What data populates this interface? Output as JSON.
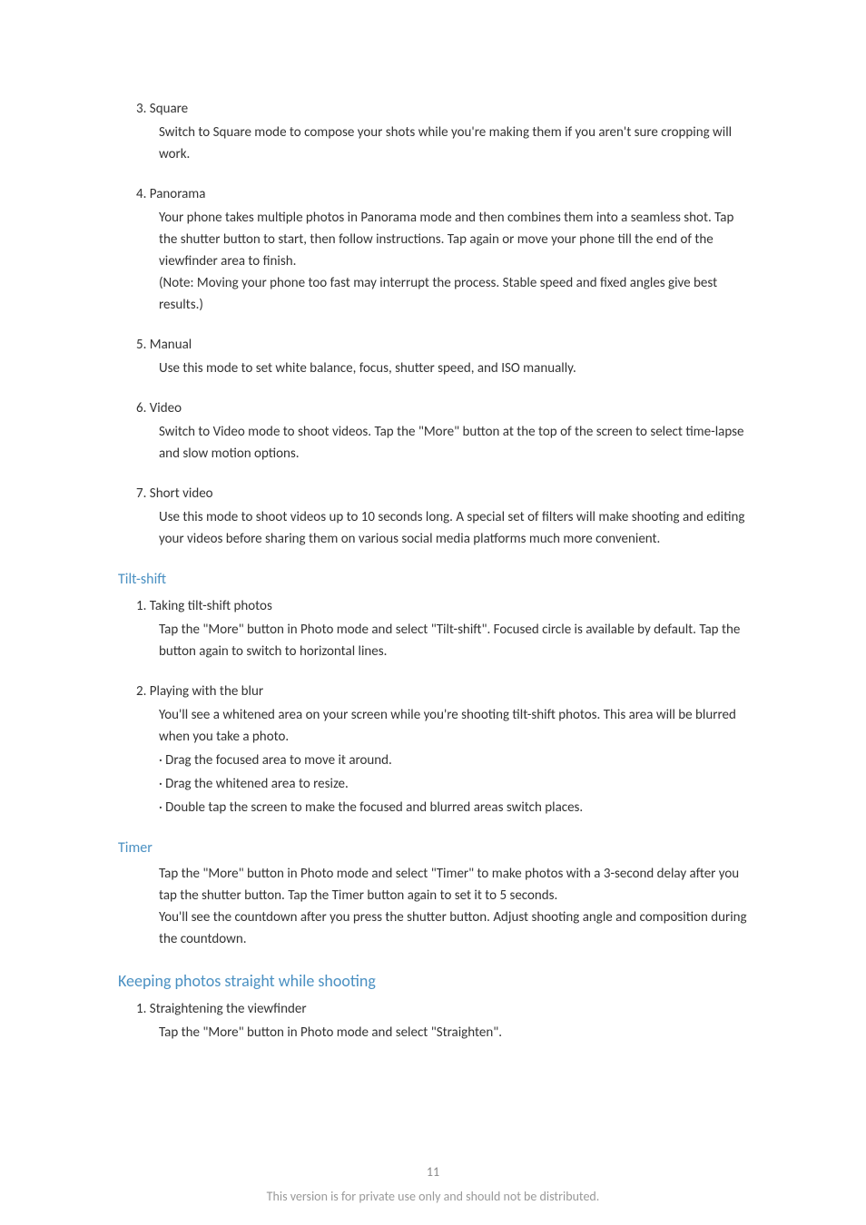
{
  "items": [
    {
      "number": "3.",
      "title": "Square",
      "body": [
        "Switch to Square mode to compose your shots while you're making them if you aren't sure cropping will work."
      ]
    },
    {
      "number": "4.",
      "title": "Panorama",
      "body": [
        "Your phone takes multiple photos in Panorama mode and then combines them into a seamless shot. Tap the shutter button to start, then follow instructions. Tap again or move your phone till the end of the viewfinder area to finish.",
        "(Note: Moving your phone too fast may interrupt the process. Stable speed and fixed angles give best results.)"
      ]
    },
    {
      "number": "5.",
      "title": "Manual",
      "body": [
        "Use this mode to set white balance, focus, shutter speed, and ISO manually."
      ]
    },
    {
      "number": "6.",
      "title": "Video",
      "body": [
        "Switch to Video mode to shoot videos. Tap the \"More\" button at the top of the screen to select time-lapse and slow motion options."
      ]
    },
    {
      "number": "7.",
      "title": "Short video",
      "body": [
        "Use this mode to shoot videos up to 10 seconds long. A special set of filters will make shooting and editing your videos before sharing them on various social media platforms much more convenient."
      ]
    }
  ],
  "tiltshift": {
    "heading": "Tilt-shift",
    "items": [
      {
        "number": "1.",
        "title": "Taking tilt-shift photos",
        "body": [
          "Tap the \"More\" button in Photo mode and select \"Tilt-shift\". Focused circle is available by default. Tap the button again to switch to horizontal lines."
        ]
      },
      {
        "number": "2.",
        "title": "Playing with the blur",
        "body": [
          "You'll see a whitened area on your screen while you're shooting tilt-shift photos. This area will be blurred when you take a photo.",
          "· Drag the focused area to move it around.",
          "· Drag the whitened area to resize.",
          "· Double tap the screen to make the focused and blurred areas switch places."
        ]
      }
    ]
  },
  "timer": {
    "heading": "Timer",
    "body": [
      "Tap the \"More\" button in Photo mode and select \"Timer\" to make photos with a 3-second delay after you tap the shutter button. Tap the Timer button again to set it to 5 seconds.",
      "You'll see the countdown after you press the shutter button. Adjust shooting angle and composition during the countdown."
    ]
  },
  "keeping": {
    "heading": "Keeping photos straight while shooting",
    "items": [
      {
        "number": "1.",
        "title": "Straightening the viewfinder",
        "body": [
          "Tap the \"More\" button in Photo mode and select \"Straighten\"."
        ]
      }
    ]
  },
  "footer": {
    "page": "11",
    "notice": "This version is for private use only and should not be distributed."
  }
}
